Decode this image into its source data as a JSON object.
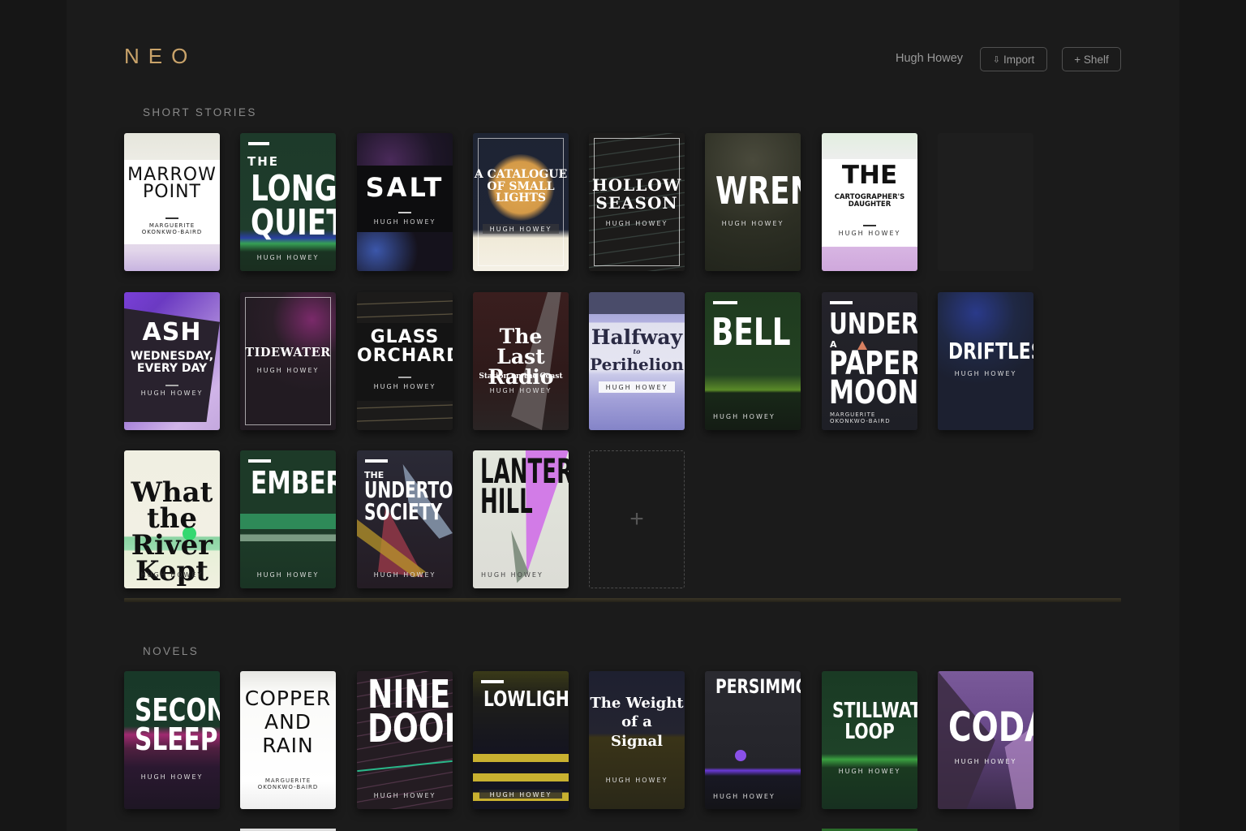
{
  "header": {
    "logo": "NEO",
    "user": "Hugh Howey",
    "import_label": "Import",
    "import_icon": "download-arrow-icon",
    "shelf_label": "+ Shelf"
  },
  "sections": {
    "short_stories": {
      "label": "SHORT STORIES"
    },
    "novels": {
      "label": "NOVELS"
    }
  },
  "add_slot": {
    "label": "+"
  },
  "short_stories": [
    {
      "title": "MARROW\nPOINT",
      "author": "MARGUERITE\nOKONKWO-BAIRD"
    },
    {
      "title_prefix": "THE",
      "title": "LONG\nQUIET",
      "author": "HUGH HOWEY"
    },
    {
      "title": "SALT",
      "author": "HUGH HOWEY"
    },
    {
      "title": "A CATALOGUE\nOF SMALL\nLIGHTS",
      "author": "HUGH HOWEY"
    },
    {
      "title": "HOLLOW\nSEASON",
      "author": "HUGH HOWEY"
    },
    {
      "title": "WREN",
      "author": "HUGH HOWEY"
    },
    {
      "title_prefix": "THE",
      "title": "CARTOGRAPHER'S\nDAUGHTER",
      "author": "HUGH HOWEY"
    },
    {
      "title": "ASH",
      "subtitle": "WEDNESDAY,\nEVERY DAY",
      "author": "HUGH HOWEY"
    },
    {
      "title": "TIDEWATER",
      "author": "HUGH HOWEY"
    },
    {
      "title": "GLASS\nORCHARD",
      "author": "HUGH HOWEY"
    },
    {
      "title": "The Last\nRadio",
      "subtitle": "Station on the Coast",
      "author": "HUGH HOWEY"
    },
    {
      "title": "Halfway",
      "connector": "to",
      "title2": "Perihelion",
      "author": "HUGH HOWEY"
    },
    {
      "title": "BELL",
      "author": "HUGH HOWEY"
    },
    {
      "title": "UNDER",
      "connector": "A",
      "title2": "PAPER\nMOON",
      "author": "MARGUERITE\nOKONKWO-BAIRD"
    },
    {
      "title": "DRIFTLESS",
      "author": "HUGH HOWEY"
    },
    {
      "title": "What\nthe River\nKept",
      "author": "HUGH HOWEY"
    },
    {
      "title": "EMBER",
      "author": "HUGH HOWEY"
    },
    {
      "title_prefix": "THE",
      "title": "UNDERTOW\nSOCIETY",
      "author": "HUGH HOWEY"
    },
    {
      "title": "LANTERN\nHILL",
      "author": "HUGH HOWEY"
    }
  ],
  "novels": [
    {
      "title": "SECOND\nSLEEP",
      "author": "HUGH HOWEY"
    },
    {
      "title": "COPPER\nAND\nRAIN",
      "author": "MARGUERITE\nOKONKWO-BAIRD"
    },
    {
      "title": "NINE\nDOORS",
      "author": "HUGH HOWEY"
    },
    {
      "title": "LOWLIGHT",
      "author": "HUGH HOWEY"
    },
    {
      "title": "The Weight\nof a\nSignal",
      "author": "HUGH HOWEY"
    },
    {
      "title": "PERSIMMON",
      "author": "HUGH HOWEY"
    },
    {
      "title": "STILLWATER\nLOOP",
      "author": "HUGH HOWEY"
    },
    {
      "title": "CODA",
      "author": "HUGH HOWEY"
    }
  ],
  "colors": {
    "accent": "#c9a36a",
    "background": "#161616"
  }
}
